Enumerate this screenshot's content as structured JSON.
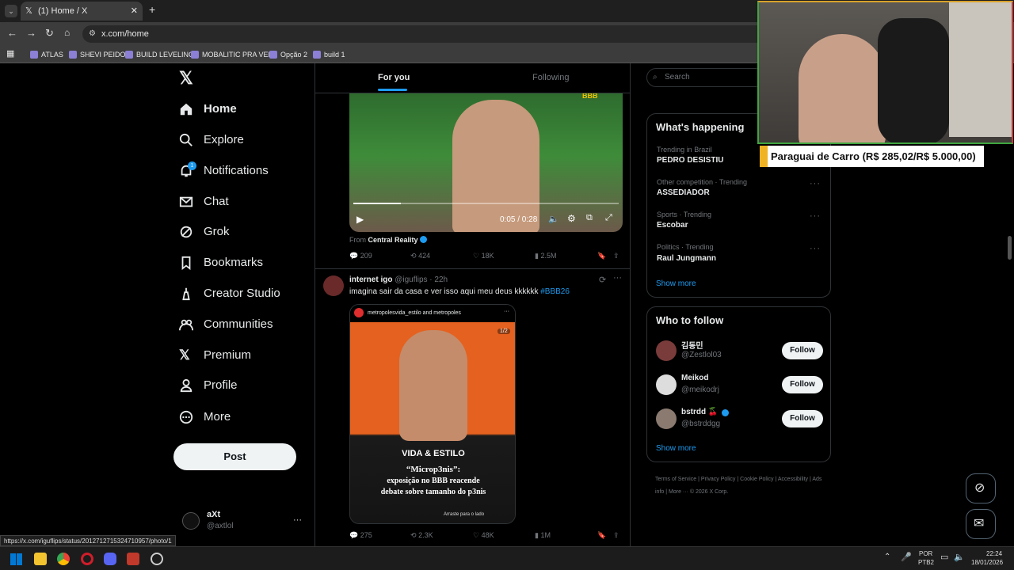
{
  "browser": {
    "tab_title": "(1) Home / X",
    "url": "x.com/home",
    "bookmarks": [
      "ATLAS",
      "SHEVI PEIDO",
      "BUILD LEVELING",
      "MOBALITIC PRA VER",
      "Opção 2",
      "build 1"
    ],
    "status_url": "https://x.com/iguflips/status/2012712715324710957/photo/1"
  },
  "nav": {
    "items": [
      "Home",
      "Explore",
      "Notifications",
      "Chat",
      "Grok",
      "Bookmarks",
      "Creator Studio",
      "Communities",
      "Premium",
      "Profile",
      "More"
    ],
    "notif_badge": "1",
    "post_label": "Post",
    "account_name": "aXt",
    "account_handle": "@axtlol",
    "account_more": "···"
  },
  "timeline": {
    "tab_for_you": "For you",
    "tab_following": "Following",
    "post1": {
      "video_time": "0:05 / 0:28",
      "video_watermark": "BBB",
      "from_label": "From",
      "from_source": "Central Reality",
      "replies": "209",
      "reposts": "424",
      "likes": "18K",
      "views": "2.5M"
    },
    "post2": {
      "author": "internet igo",
      "handle": "@iguflips",
      "time": "· 22h",
      "text": "imagina sair da casa e ver isso aqui meu deus kkkkkk",
      "hashtag": "#BBB26",
      "embed_header": "metropolesvida_estilo",
      "embed_header_and": "and",
      "embed_header_2": "metropoles",
      "embed_counter": "1/2",
      "embed_brand": "VIDA & ESTILO",
      "embed_quote": "“Microp3nis”:",
      "embed_line2": "exposição no BBB reacende",
      "embed_line3": "debate sobre tamanho do p3nis",
      "embed_swipe": "Arraste para o lado",
      "replies": "275",
      "reposts": "2.3K",
      "likes": "48K",
      "views": "1M"
    }
  },
  "sidebar": {
    "search_placeholder": "Search",
    "whats_happening": "What's happening",
    "trends": [
      {
        "meta": "Trending in Brazil",
        "name": "PEDRO DESISTIU"
      },
      {
        "meta": "Other competition · Trending",
        "name": "ASSEDIADOR"
      },
      {
        "meta": "Sports · Trending",
        "name": "Escobar"
      },
      {
        "meta": "Politics · Trending",
        "name": "Raul Jungmann"
      }
    ],
    "show_more": "Show more",
    "who_to_follow": "Who to follow",
    "follow": [
      {
        "name": "김동민",
        "handle": "@Zestlol03"
      },
      {
        "name": "Meikod",
        "handle": "@meikodrj"
      },
      {
        "name": "bstrdd 🍒",
        "handle": "@bstrddgg"
      }
    ],
    "follow_label": "Follow",
    "footer": [
      "Terms of Service",
      "Privacy Policy",
      "Cookie Policy",
      "Accessibility",
      "Ads info",
      "More ···",
      "© 2026 X Corp."
    ]
  },
  "overlay": {
    "banner": "Paraguai de Carro (R$ 285,02/R$ 5.000,00)"
  },
  "taskbar": {
    "lang": "POR",
    "layout": "PTB2",
    "time": "22:24",
    "date": "18/01/2026"
  },
  "colors": {
    "accent": "#1d9bf0",
    "bg": "#000000",
    "border": "#2f3336",
    "muted": "#71767b"
  }
}
